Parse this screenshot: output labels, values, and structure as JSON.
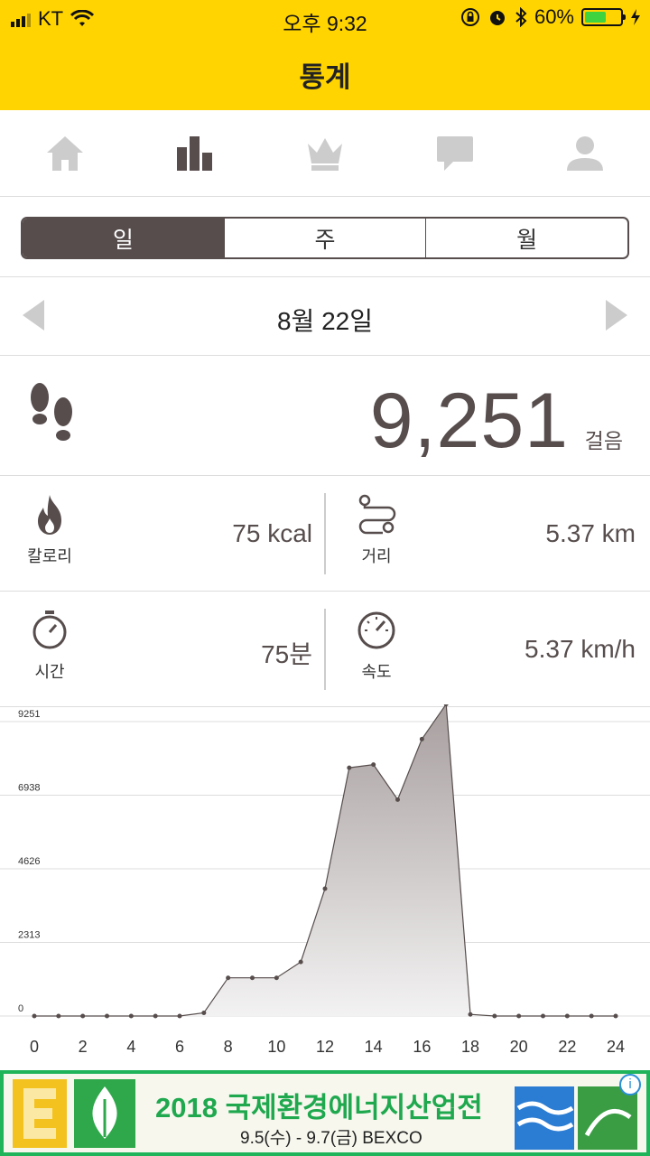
{
  "status_bar": {
    "carrier": "KT",
    "time": "오후 9:32",
    "battery": "60%",
    "battery_level": 0.6
  },
  "header": {
    "title": "통계"
  },
  "nav_tabs": [
    {
      "icon": "home-icon",
      "active": false
    },
    {
      "icon": "bar-chart-icon",
      "active": true
    },
    {
      "icon": "crown-icon",
      "active": false
    },
    {
      "icon": "chat-bubble-icon",
      "active": false
    },
    {
      "icon": "person-icon",
      "active": false
    }
  ],
  "period": {
    "options": [
      "일",
      "주",
      "월"
    ],
    "selected": "일"
  },
  "date_nav": {
    "label": "8월 22일"
  },
  "steps": {
    "value": "9,251",
    "unit": "걸음"
  },
  "stats": {
    "calories": {
      "label": "칼로리",
      "value": "75 kcal"
    },
    "distance": {
      "label": "거리",
      "value": "5.37 km"
    },
    "time": {
      "label": "시간",
      "value": "75분"
    },
    "speed": {
      "label": "속도",
      "value": "5.37 km/h"
    }
  },
  "colors": {
    "accent": "#FFD400",
    "primary": "#574d4d",
    "ad_green": "#1fa84e"
  },
  "chart_data": {
    "type": "area",
    "x": [
      0,
      1,
      2,
      3,
      4,
      5,
      6,
      7,
      8,
      9,
      10,
      11,
      12,
      13,
      14,
      15,
      16,
      17,
      18,
      19,
      20,
      21,
      22,
      23,
      24
    ],
    "values": [
      0,
      0,
      0,
      0,
      0,
      0,
      0,
      100,
      1200,
      1200,
      1200,
      1700,
      4000,
      7800,
      7900,
      6800,
      8700,
      9800,
      50,
      0,
      0,
      0,
      0,
      0,
      0
    ],
    "y_ticks": [
      "0",
      "2313",
      "4626",
      "6938",
      "9251"
    ],
    "x_ticks": [
      "0",
      "2",
      "4",
      "6",
      "8",
      "10",
      "12",
      "14",
      "16",
      "18",
      "20",
      "22",
      "24"
    ],
    "ylim": [
      0,
      9251
    ],
    "xlim": [
      0,
      24
    ],
    "grid": true
  },
  "ad": {
    "title": "2018 국제환경에너지산업전",
    "subtitle": "9.5(수) - 9.7(금) BEXCO",
    "info": "i"
  }
}
